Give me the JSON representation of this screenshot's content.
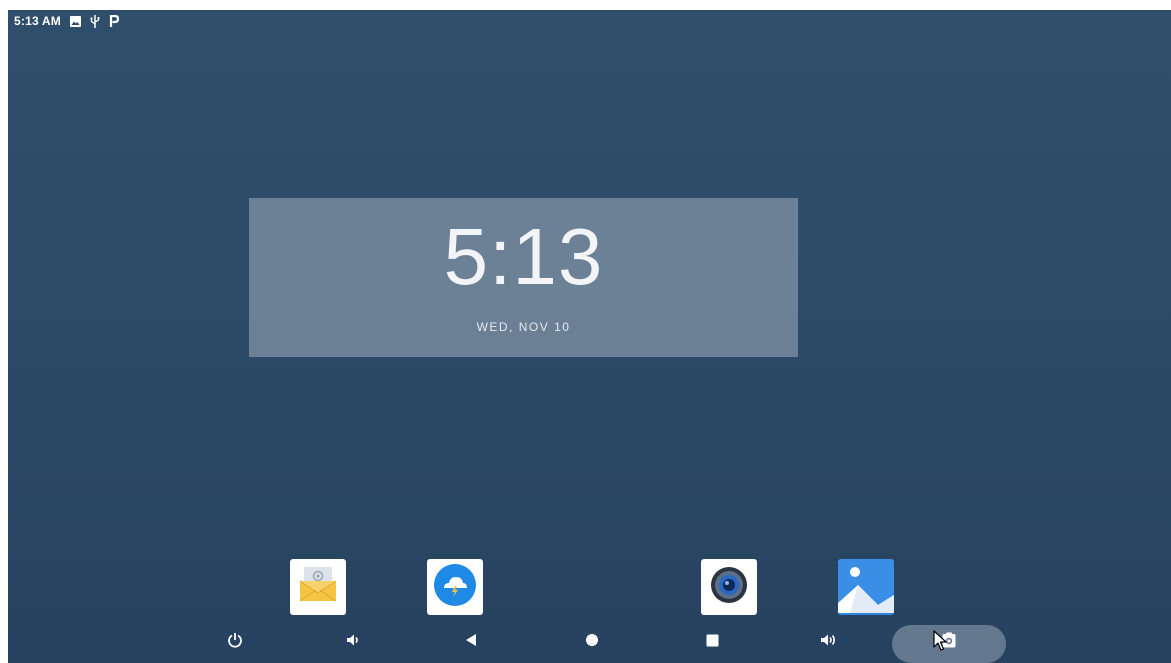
{
  "status_bar": {
    "time": "5:13 AM",
    "icons": [
      "image-icon",
      "usb-icon",
      "p-icon"
    ]
  },
  "clock": {
    "time": "5:13",
    "date": "WED, NOV 10"
  },
  "dock": {
    "apps": [
      {
        "name": "email-app",
        "icon": "mail-icon"
      },
      {
        "name": "browser-app",
        "icon": "cloud-lightning-icon"
      },
      {
        "name": "music-app",
        "icon": "speaker-icon"
      },
      {
        "name": "gallery-app",
        "icon": "gallery-icon"
      }
    ]
  },
  "nav_bar": {
    "buttons": [
      "power-icon",
      "volume-down-icon",
      "back-icon",
      "home-icon",
      "recents-icon",
      "volume-up-icon",
      "screenshot-icon"
    ]
  },
  "colors": {
    "background": "#2c4b69",
    "widget": "#96a5b4",
    "accent_blue": "#1f8ae6",
    "mail_yellow": "#f4c543"
  }
}
